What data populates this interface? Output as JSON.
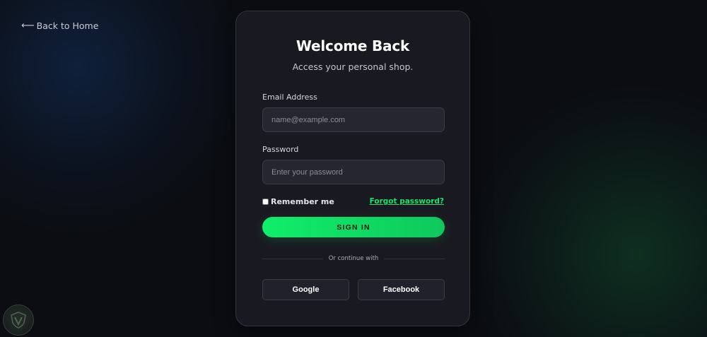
{
  "nav": {
    "back_arrow": "⟵",
    "back_label": "Back to Home"
  },
  "card": {
    "title": "Welcome Back",
    "subtitle": "Access your personal shop."
  },
  "form": {
    "email_label": "Email Address",
    "email_placeholder": "name@example.com",
    "email_value": "",
    "password_label": "Password",
    "password_placeholder": "Enter your password",
    "password_value": "",
    "remember_label": "Remember me",
    "remember_checked": false,
    "forgot_label": "Forgot password?",
    "submit_label": "SIGN IN"
  },
  "social": {
    "divider_text": "Or continue with",
    "google_label": "Google",
    "facebook_label": "Facebook"
  },
  "theme": {
    "background": "#0b0d12",
    "card_background": "#191a21",
    "input_background": "#252630",
    "accent_green": "#10ee6a",
    "link_green": "#22e06a"
  },
  "icons": {
    "back": "arrow-left-icon",
    "corner_badge": "shield-logo-icon"
  }
}
